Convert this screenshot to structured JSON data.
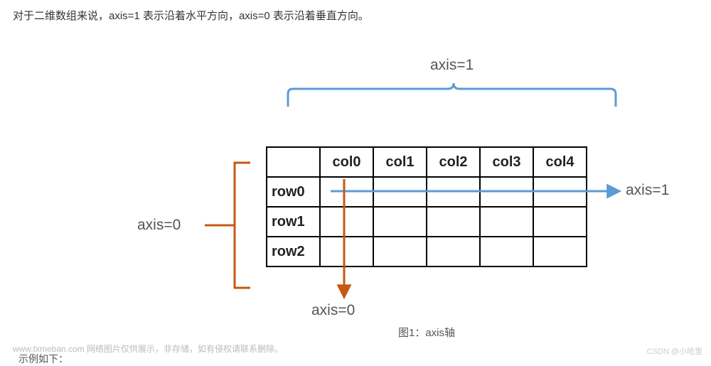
{
  "intro": "对于二维数组来说，axis=1 表示沿着水平方向，axis=0 表示沿着垂直方向。",
  "labels": {
    "axis1_top": "axis=1",
    "axis1_right": "axis=1",
    "axis0_left": "axis=0",
    "axis0_bottom": "axis=0"
  },
  "grid": {
    "cols": [
      "col0",
      "col1",
      "col2",
      "col3",
      "col4"
    ],
    "rows": [
      "row0",
      "row1",
      "row2"
    ]
  },
  "caption": "图1：axis轴",
  "footer": "www.txmeban.com 网络图片仅供展示，非存储，如有侵权请联系删除。",
  "watermark": "CSDN @小哈里",
  "cutoff": "示例如下："
}
